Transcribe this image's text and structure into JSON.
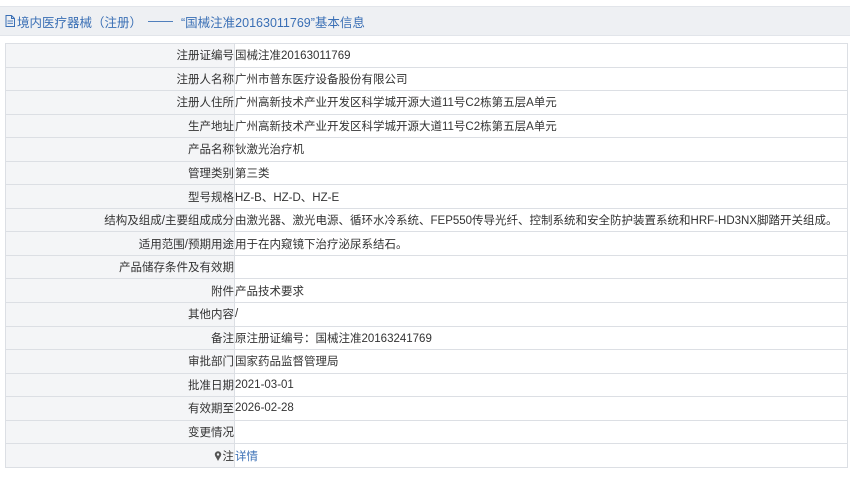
{
  "header": {
    "section": "境内医疗器械（注册）",
    "separator": "——",
    "title": "“国械注准20163011769”基本信息",
    "accent_color": "#3a6fb5"
  },
  "rows": [
    {
      "label": "注册证编号",
      "value": "国械注准20163011769"
    },
    {
      "label": "注册人名称",
      "value": "广州市普东医疗设备股份有限公司"
    },
    {
      "label": "注册人住所",
      "value": "广州高新技术产业开发区科学城开源大道11号C2栋第五层A单元"
    },
    {
      "label": "生产地址",
      "value": "广州高新技术产业开发区科学城开源大道11号C2栋第五层A单元"
    },
    {
      "label": "产品名称",
      "value": "钬激光治疗机"
    },
    {
      "label": "管理类别",
      "value": "第三类"
    },
    {
      "label": "型号规格",
      "value": "HZ-B、HZ-D、HZ-E"
    },
    {
      "label": "结构及组成/主要组成成分",
      "value": "由激光器、激光电源、循环水冷系统、FEP550传导光纤、控制系统和安全防护装置系统和HRF-HD3NX脚踏开关组成。"
    },
    {
      "label": "适用范围/预期用途",
      "value": "用于在内窥镜下治疗泌尿系结石。"
    },
    {
      "label": "产品储存条件及有效期",
      "value": ""
    },
    {
      "label": "附件",
      "value": "产品技术要求"
    },
    {
      "label": "其他内容",
      "value": "/"
    },
    {
      "label": "备注",
      "value": "原注册证编号：国械注准20163241769"
    },
    {
      "label": "审批部门",
      "value": "国家药品监督管理局"
    },
    {
      "label": "批准日期",
      "value": "2021-03-01"
    },
    {
      "label": "有效期至",
      "value": "2026-02-28"
    },
    {
      "label": "变更情况",
      "value": ""
    }
  ],
  "note_row": {
    "icon": "pin-icon",
    "label": "注",
    "link": "详情"
  }
}
